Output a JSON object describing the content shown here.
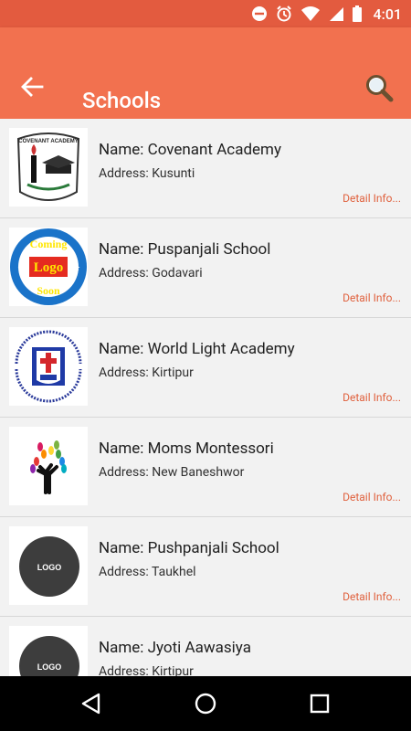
{
  "status": {
    "time": "4:01"
  },
  "appbar": {
    "title": "Schools"
  },
  "schools": [
    {
      "name": "Name: Covenant Academy",
      "address": "Address: Kusunti",
      "detail": "Detail Info..."
    },
    {
      "name": "Name: Puspanjali School",
      "address": "Address: Godavari",
      "detail": "Detail Info..."
    },
    {
      "name": "Name: World Light Academy",
      "address": "Address: Kirtipur",
      "detail": "Detail Info..."
    },
    {
      "name": "Name: Moms Montessori",
      "address": "Address: New Baneshwor",
      "detail": "Detail Info..."
    },
    {
      "name": "Name: Pushpanjali School",
      "address": "Address: Taukhel",
      "detail": "Detail Info..."
    },
    {
      "name": "Name: Jyoti Aawasiya",
      "address": "Address: Kirtipur",
      "detail": ""
    }
  ],
  "logos": {
    "covenant_text": "COVENANT ACADEMY",
    "coming_soon_top": "Coming",
    "coming_soon_mid": "Logo",
    "coming_soon_bottom": "Soon",
    "placeholder": "LOGO"
  },
  "colors": {
    "statusbar": "#e35b3f",
    "appbar": "#f2714f",
    "accent": "#e0623f"
  }
}
